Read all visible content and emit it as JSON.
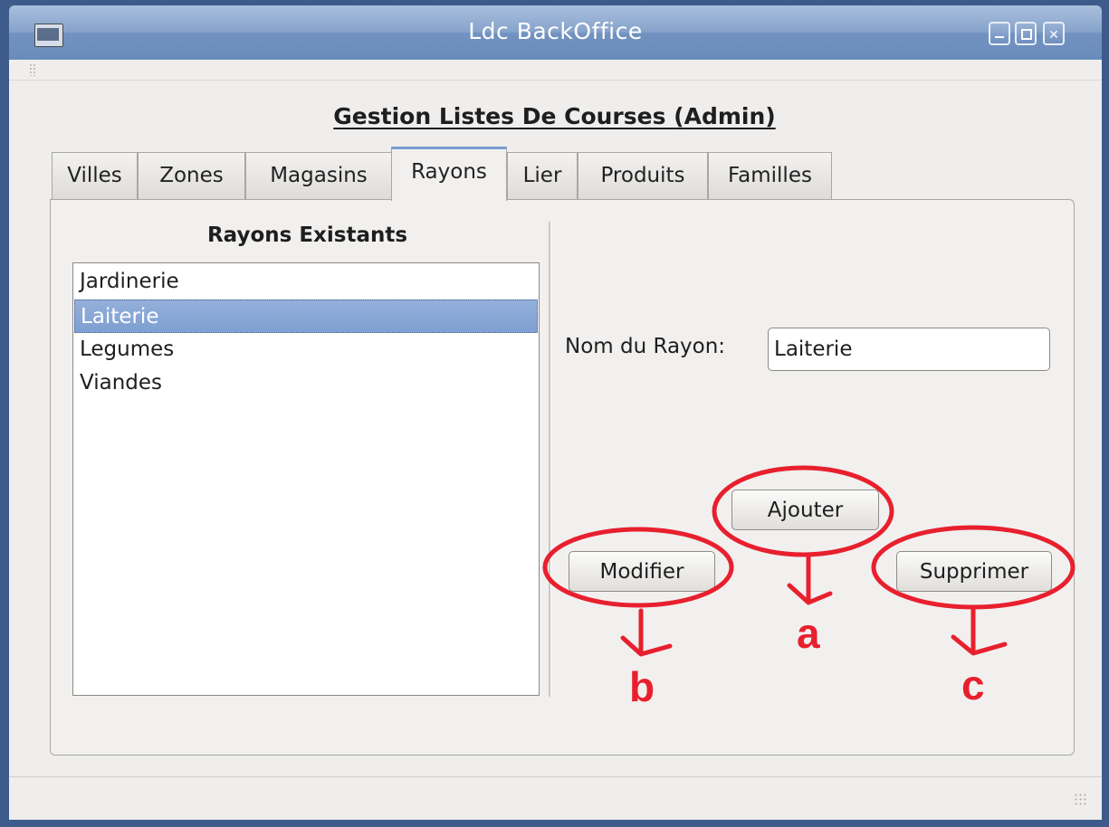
{
  "window": {
    "title": "Ldc BackOffice"
  },
  "heading": "Gestion Listes De Courses (Admin)",
  "tabs": [
    {
      "label": "Villes",
      "active": false
    },
    {
      "label": "Zones",
      "active": false
    },
    {
      "label": "Magasins",
      "active": false
    },
    {
      "label": "Rayons",
      "active": true
    },
    {
      "label": "Lier",
      "active": false
    },
    {
      "label": "Produits",
      "active": false
    },
    {
      "label": "Familles",
      "active": false
    }
  ],
  "list": {
    "title": "Rayons Existants",
    "items": [
      "Jardinerie",
      "Laiterie",
      "Legumes",
      "Viandes"
    ],
    "selected": "Laiterie"
  },
  "form": {
    "label": "Nom du Rayon:",
    "value": "Laiterie"
  },
  "buttons": {
    "ajouter": "Ajouter",
    "modifier": "Modifier",
    "supprimer": "Supprimer"
  },
  "annotations": {
    "a": "a",
    "b": "b",
    "c": "c",
    "color": "#e8202e"
  },
  "colors": {
    "titlebar": "#7192c1",
    "selection": "#87a6d6",
    "window_bg": "#efeeed"
  }
}
